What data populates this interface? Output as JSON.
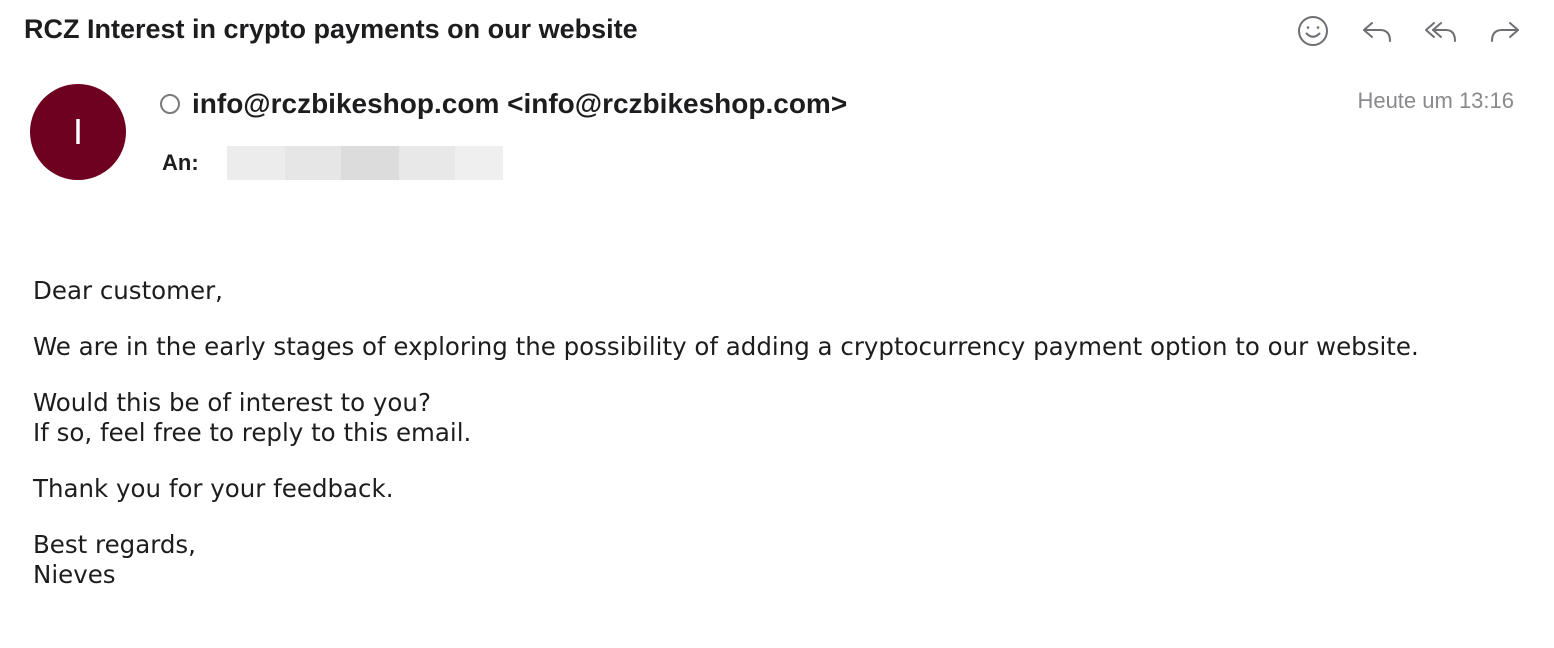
{
  "email": {
    "subject": "RCZ Interest in crypto payments on our website",
    "sender": "info@rczbikeshop.com <info@rczbikeshop.com>",
    "avatar_initial": "I",
    "avatar_color": "#6e0020",
    "timestamp": "Heute um 13:16",
    "to_label": "An:",
    "body": {
      "greeting": "Dear customer,",
      "paragraph1": "We are in the early stages of exploring the possibility of adding a cryptocurrency payment option to our website.",
      "question_line1": "Would this be of interest to you?",
      "question_line2": "If so, feel free to reply to this email.",
      "thanks": "Thank you for your feedback.",
      "closing": "Best regards,",
      "signature": "Nieves"
    }
  },
  "toolbar": {
    "icons": [
      "smiley-icon",
      "reply-icon",
      "reply-all-icon",
      "forward-icon"
    ]
  }
}
